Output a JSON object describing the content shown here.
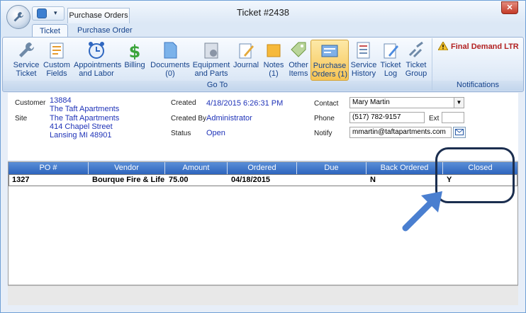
{
  "window": {
    "title": "Ticket #2438",
    "close": "✕"
  },
  "doc_tab": "Purchase Orders",
  "qat_dropdown": "▾",
  "tabs": [
    "Ticket",
    "Purchase Order"
  ],
  "ribbon": {
    "goto": {
      "label": "Go To",
      "buttons": [
        {
          "l1": "Service",
          "l2": "Ticket",
          "icon": "wrench-icon"
        },
        {
          "l1": "Custom",
          "l2": "Fields",
          "icon": "custom-fields-icon"
        },
        {
          "l1": "Appointments",
          "l2": "and Labor",
          "icon": "clock-icon"
        },
        {
          "l1": "Billing",
          "l2": "",
          "icon": "dollar-icon"
        },
        {
          "l1": "Documents",
          "l2": "(0)",
          "icon": "document-icon"
        },
        {
          "l1": "Equipment",
          "l2": "and Parts",
          "icon": "equipment-icon"
        },
        {
          "l1": "Journal",
          "l2": "",
          "icon": "journal-icon"
        },
        {
          "l1": "Notes",
          "l2": "(1)",
          "icon": "notes-icon"
        },
        {
          "l1": "Other",
          "l2": "Items",
          "icon": "tag-icon"
        },
        {
          "l1": "Purchase",
          "l2": "Orders (1)",
          "icon": "purchase-orders-icon"
        },
        {
          "l1": "Service",
          "l2": "History",
          "icon": "history-icon"
        },
        {
          "l1": "Ticket",
          "l2": "Log",
          "icon": "ticket-log-icon"
        },
        {
          "l1": "Ticket",
          "l2": "Group",
          "icon": "ticket-group-icon"
        }
      ]
    },
    "notifications": {
      "label": "Notifications",
      "text": "Final Demand LTR",
      "icon": "warning-icon"
    }
  },
  "info": {
    "customer_label": "Customer",
    "customer_id": "13884",
    "customer_name": "The Taft Apartments",
    "site_label": "Site",
    "site_name": "The Taft Apartments",
    "site_street": "414 Chapel Street",
    "site_city": "Lansing MI 48901",
    "created_label": "Created",
    "created_value": "4/18/2015 6:26:31 PM",
    "created_by_label": "Created By",
    "created_by_value": "Administrator",
    "status_label": "Status",
    "status_value": "Open",
    "contact_label": "Contact",
    "contact_value": "Mary Martin",
    "phone_label": "Phone",
    "phone_value": "(517) 782-9157",
    "ext_label": "Ext",
    "ext_value": "",
    "notify_label": "Notify",
    "notify_value": "mmartin@taftapartments.com"
  },
  "grid": {
    "columns": [
      "PO #",
      "Vendor",
      "Amount",
      "Ordered",
      "Due",
      "Back Ordered",
      "Closed"
    ],
    "rows": [
      [
        "1327",
        "Bourque Fire & Life Saf...",
        "75.00",
        "04/18/2015",
        "",
        "N",
        "Y"
      ]
    ]
  },
  "colors": {
    "accent": "#2d64bd",
    "link": "#1f33b8",
    "callout": "#1b2e4f",
    "arrow": "#4a7fd0",
    "selected": "#f6c453"
  }
}
